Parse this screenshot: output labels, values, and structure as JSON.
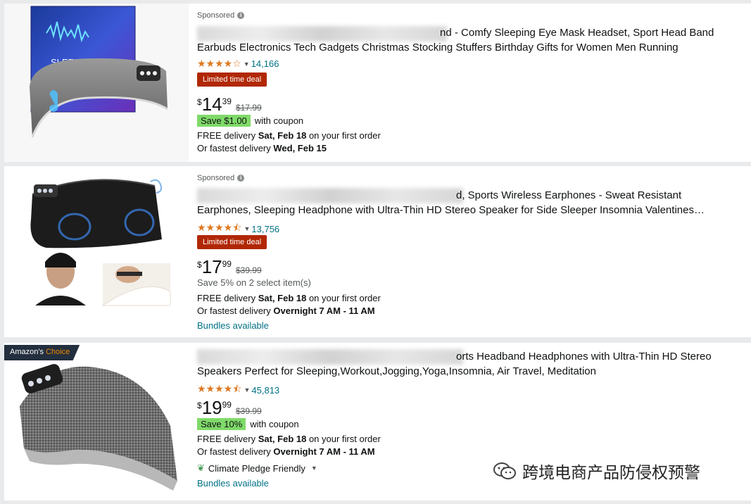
{
  "results": [
    {
      "sponsored_label": "Sponsored",
      "title_visible_1": "nd - Comfy Sleeping Eye Mask Headset, Sport Head Band",
      "title_line_2": "Earbuds Electronics Tech Gadgets Christmas Stocking Stuffers Birthday Gifts for Women Men Running",
      "stars": "★★★★☆",
      "rating_value": 4.0,
      "review_count": "14,166",
      "deal_badge": "Limited time deal",
      "price_symbol": "$",
      "price_whole": "14",
      "price_fraction": "39",
      "list_price": "$17.99",
      "coupon_badge": "Save $1.00",
      "coupon_text": "with coupon",
      "delivery_prefix": "FREE delivery ",
      "delivery_date": "Sat, Feb 18",
      "delivery_suffix": " on your first order",
      "fastest_prefix": "Or fastest delivery ",
      "fastest_date": "Wed, Feb 15",
      "image_text": "SLEEP HEA"
    },
    {
      "sponsored_label": "Sponsored",
      "title_visible_1": "d, Sports Wireless Earphones - Sweat Resistant",
      "title_line_2": "Earphones, Sleeping Headphone with Ultra-Thin HD Stereo Speaker for Side Sleeper Insomnia Valentines…",
      "stars": "★★★★⯪",
      "rating_value": 4.5,
      "review_count": "13,756",
      "deal_badge": "Limited time deal",
      "price_symbol": "$",
      "price_whole": "17",
      "price_fraction": "99",
      "list_price": "$39.99",
      "save_text": "Save 5% on 2 select item(s)",
      "delivery_prefix": "FREE delivery ",
      "delivery_date": "Sat, Feb 18",
      "delivery_suffix": " on your first order",
      "fastest_prefix": "Or fastest delivery ",
      "fastest_date": "Overnight 7 AM - 11 AM",
      "bundles": "Bundles available"
    },
    {
      "badge_prefix": "Amazon's ",
      "badge_suffix": "Choice",
      "title_visible_1": "orts Headband Headphones with Ultra-Thin HD Stereo",
      "title_line_2": "Speakers Perfect for Sleeping,Workout,Jogging,Yoga,Insomnia, Air Travel, Meditation",
      "stars": "★★★★⯪",
      "rating_value": 4.5,
      "review_count": "45,813",
      "price_symbol": "$",
      "price_whole": "19",
      "price_fraction": "99",
      "list_price": "$39.99",
      "coupon_badge": "Save 10%",
      "coupon_text": "with coupon",
      "delivery_prefix": "FREE delivery ",
      "delivery_date": "Sat, Feb 18",
      "delivery_suffix": " on your first order",
      "fastest_prefix": "Or fastest delivery ",
      "fastest_date": "Overnight 7 AM - 11 AM",
      "pledge": "Climate Pledge Friendly",
      "bundles": "Bundles available"
    }
  ],
  "watermark": "跨境电商产品防侵权预警",
  "colors": {
    "star": "#de7921",
    "link": "#007185",
    "deal": "#b12704",
    "coupon": "#7fda69",
    "choice_bg": "#232f3e",
    "choice_accent": "#f08804"
  }
}
